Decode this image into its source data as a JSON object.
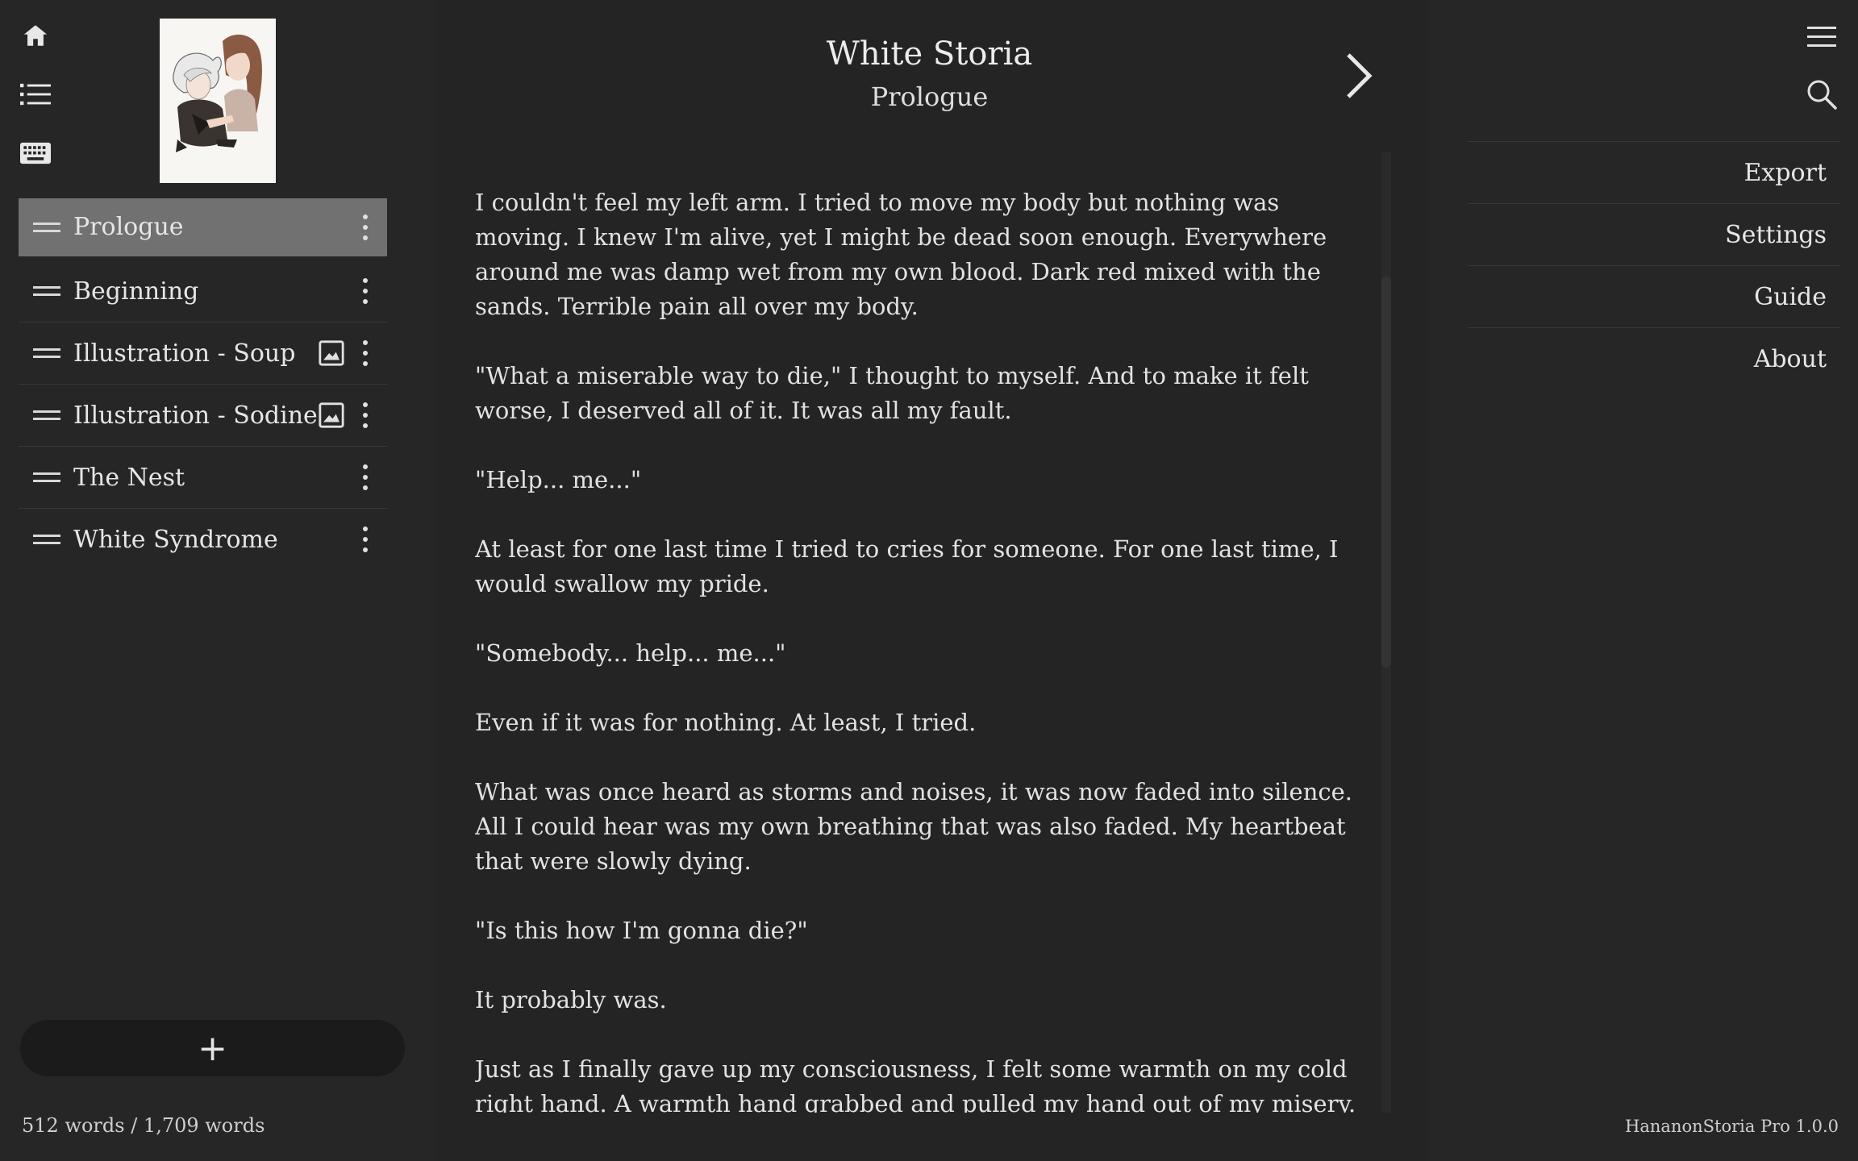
{
  "rail": {
    "home_icon": "home-icon",
    "list_icon": "list-icon",
    "keyboard_icon": "keyboard-icon"
  },
  "chapters": [
    {
      "label": "Prologue",
      "active": true,
      "has_image": false
    },
    {
      "label": "Beginning",
      "active": false,
      "has_image": false
    },
    {
      "label": "Illustration - Soup",
      "active": false,
      "has_image": true
    },
    {
      "label": "Illustration - Sodine",
      "active": false,
      "has_image": true
    },
    {
      "label": "The Nest",
      "active": false,
      "has_image": false
    },
    {
      "label": "White Syndrome",
      "active": false,
      "has_image": false
    }
  ],
  "add_label": "+",
  "word_count": "512 words / 1,709 words",
  "reader": {
    "book_title": "White Storia",
    "chapter_title": "Prologue",
    "paragraphs": [
      "I couldn't feel my left arm. I tried to move my body but nothing was moving. I knew I'm alive, yet I might be dead soon enough. Everywhere around me was damp wet from my own blood. Dark red mixed with the sands. Terrible pain all over my body.",
      "\"What a miserable way to die,\" I thought to myself. And to make it felt worse, I deserved all of it. It was all my fault.",
      "\"Help... me...\"",
      "At least for one last time I tried to cries for someone. For one last time, I would swallow my pride.",
      "\"Somebody... help... me...\"",
      "Even if it was for nothing. At least, I tried.",
      "What was once heard as storms and noises, it was now faded into silence. All I could hear was my own breathing that was also faded. My heartbeat that were slowly dying.",
      "\"Is this how I'm gonna die?\"",
      "It probably was.",
      "Just as I finally gave up my consciousness, I felt some warmth on my cold right hand. A warmth hand grabbed and pulled my hand out of my misery."
    ]
  },
  "menu": {
    "items": [
      "Export",
      "Settings",
      "Guide",
      "About"
    ]
  },
  "version": "HananonStoria Pro 1.0.0"
}
